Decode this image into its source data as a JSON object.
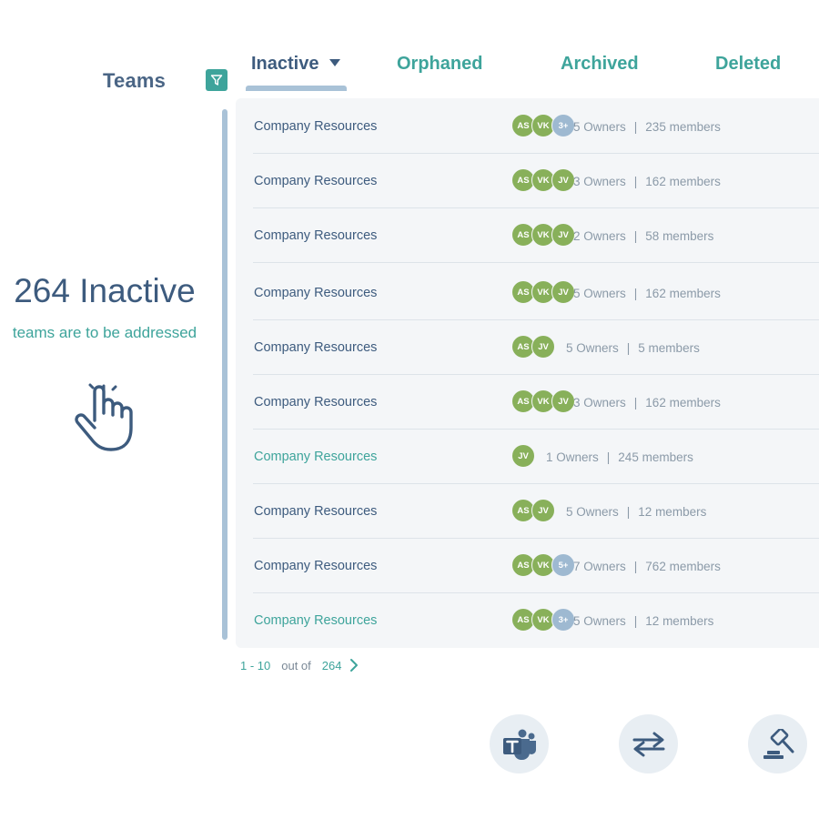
{
  "header": {
    "title": "Teams",
    "filter_icon": "filter-icon",
    "tabs": [
      {
        "label": "Inactive",
        "active": true
      },
      {
        "label": "Orphaned",
        "active": false
      },
      {
        "label": "Archived",
        "active": false
      },
      {
        "label": "Deleted",
        "active": false
      }
    ]
  },
  "summary": {
    "count_text": "264 Inactive",
    "subtitle": "teams are to be addressed",
    "icon": "pointing-hand-icon"
  },
  "rows": [
    {
      "name": "Company Resources",
      "avatars": [
        "AS",
        "VK",
        "3+"
      ],
      "owners": "5 Owners",
      "members": "235 members",
      "highlight": false
    },
    {
      "name": "Company Resources",
      "avatars": [
        "AS",
        "VK",
        "JV"
      ],
      "owners": "3 Owners",
      "members": "162 members",
      "highlight": false
    },
    {
      "name": "Company Resources",
      "avatars": [
        "AS",
        "VK",
        "JV"
      ],
      "owners": "2 Owners",
      "members": "58 members",
      "highlight": false
    },
    {
      "name": "Company Resources",
      "avatars": [
        "AS",
        "VK",
        "JV"
      ],
      "owners": "5 Owners",
      "members": "162 members",
      "highlight": false
    },
    {
      "name": "Company Resources",
      "avatars": [
        "AS",
        "JV"
      ],
      "owners": "5 Owners",
      "members": "5 members",
      "highlight": false
    },
    {
      "name": "Company Resources",
      "avatars": [
        "AS",
        "VK",
        "JV"
      ],
      "owners": "3 Owners",
      "members": "162 members",
      "highlight": false
    },
    {
      "name": "Company Resources",
      "avatars": [
        "JV"
      ],
      "owners": "1 Owners",
      "members": "245 members",
      "highlight": true
    },
    {
      "name": "Company Resources",
      "avatars": [
        "AS",
        "JV"
      ],
      "owners": "5 Owners",
      "members": "12 members",
      "highlight": false
    },
    {
      "name": "Company Resources",
      "avatars": [
        "AS",
        "VK",
        "5+"
      ],
      "owners": "7 Owners",
      "members": "762 members",
      "highlight": false
    },
    {
      "name": "Company Resources",
      "avatars": [
        "AS",
        "VK",
        "3+"
      ],
      "owners": "5 Owners",
      "members": "12 members",
      "highlight": true
    }
  ],
  "pagination": {
    "range": "1 - 10",
    "out_of": "out of",
    "total": "264",
    "next_icon": "chevron-right-icon"
  },
  "actions": [
    {
      "name": "teams-button",
      "icon": "microsoft-teams-icon"
    },
    {
      "name": "transfer-button",
      "icon": "transfer-arrows-icon"
    },
    {
      "name": "judge-button",
      "icon": "gavel-icon"
    }
  ],
  "colors": {
    "primary": "#3d5b7e",
    "accent": "#3ea49b",
    "avatar": "#88b05a",
    "avatar_more": "#9eb9d1",
    "panel": "#f4f6f8"
  }
}
